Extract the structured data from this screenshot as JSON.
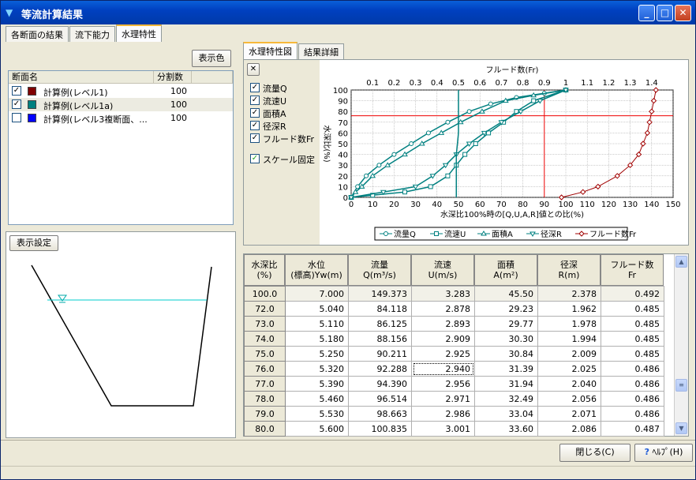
{
  "window": {
    "title": "等流計算結果"
  },
  "main_tabs": [
    "各断面の結果",
    "流下能力",
    "水理特性"
  ],
  "left": {
    "color_button": "表示色",
    "list_headers": [
      "断面名",
      "分割数"
    ],
    "rows": [
      {
        "name": "計算例(レベル1)",
        "div": "100",
        "checked": true,
        "color": "#800000"
      },
      {
        "name": "計算例(レベル1a)",
        "div": "100",
        "checked": true,
        "color": "#008080"
      },
      {
        "name": "計算例(レベル3複断面、...",
        "div": "100",
        "checked": false,
        "color": "#0000ff"
      }
    ],
    "display_settings": "表示設定"
  },
  "right_tabs": [
    "水理特性図",
    "結果詳細"
  ],
  "chart_panel": {
    "close": "✕",
    "checks": [
      "流量Q",
      "流速U",
      "面積A",
      "径深R",
      "フルード数Fr"
    ],
    "scale_fixed": "スケール固定",
    "legend": [
      "流量Q",
      "流速U",
      "面積A",
      "径深R",
      "フルード数Fr"
    ]
  },
  "chart_data": {
    "type": "line",
    "top_axis_title": "フルード数(Fr)",
    "top_ticks": [
      "0.1",
      "0.2",
      "0.3",
      "0.4",
      "0.5",
      "0.6",
      "0.7",
      "0.8",
      "0.9",
      "1",
      "1.1",
      "1.2",
      "1.3",
      "1.4"
    ],
    "ylabel": "水深比(%)",
    "yticks": [
      "0",
      "10",
      "20",
      "30",
      "40",
      "50",
      "60",
      "70",
      "80",
      "90",
      "100"
    ],
    "xlabel": "水深比100%時の[Q,U,A,R]値との比(%)",
    "xticks": [
      "0",
      "10",
      "20",
      "30",
      "40",
      "50",
      "60",
      "70",
      "80",
      "90",
      "100",
      "110",
      "120",
      "130",
      "140",
      "150"
    ],
    "xlim": [
      0,
      150
    ],
    "ylim": [
      0,
      100
    ],
    "crosshair": {
      "x": 90,
      "y": 76
    },
    "series": [
      {
        "name": "流量Q",
        "color": "#008080",
        "marker": "circle",
        "points": [
          [
            0,
            0
          ],
          [
            3,
            10
          ],
          [
            7,
            20
          ],
          [
            13,
            30
          ],
          [
            20,
            40
          ],
          [
            28,
            50
          ],
          [
            36,
            60
          ],
          [
            45,
            70
          ],
          [
            55,
            80
          ],
          [
            65,
            87
          ],
          [
            77,
            93
          ],
          [
            90,
            97
          ],
          [
            100,
            100
          ]
        ]
      },
      {
        "name": "流速U",
        "color": "#008080",
        "marker": "square",
        "points": [
          [
            0,
            0
          ],
          [
            10,
            2
          ],
          [
            25,
            5
          ],
          [
            37,
            10
          ],
          [
            45,
            20
          ],
          [
            49,
            30
          ],
          [
            53,
            40
          ],
          [
            58,
            50
          ],
          [
            64,
            60
          ],
          [
            71,
            70
          ],
          [
            77,
            80
          ],
          [
            85,
            90
          ],
          [
            100,
            100
          ]
        ]
      },
      {
        "name": "面積A",
        "color": "#008080",
        "marker": "triangle",
        "points": [
          [
            0,
            0
          ],
          [
            2,
            5
          ],
          [
            5,
            10
          ],
          [
            10,
            20
          ],
          [
            17,
            30
          ],
          [
            25,
            40
          ],
          [
            33,
            50
          ],
          [
            42,
            60
          ],
          [
            51,
            70
          ],
          [
            61,
            80
          ],
          [
            72,
            90
          ],
          [
            85,
            95
          ],
          [
            100,
            100
          ]
        ]
      },
      {
        "name": "径深R",
        "color": "#008080",
        "marker": "tri-down",
        "points": [
          [
            0,
            0
          ],
          [
            15,
            5
          ],
          [
            30,
            10
          ],
          [
            38,
            20
          ],
          [
            44,
            30
          ],
          [
            49,
            40
          ],
          [
            55,
            50
          ],
          [
            62,
            60
          ],
          [
            70,
            70
          ],
          [
            79,
            80
          ],
          [
            88,
            90
          ],
          [
            100,
            100
          ]
        ]
      },
      {
        "name": "フルード数Fr",
        "color": "#a00000",
        "marker": "diamond",
        "points": [
          [
            98,
            0
          ],
          [
            108,
            5
          ],
          [
            115,
            10
          ],
          [
            124,
            20
          ],
          [
            130,
            30
          ],
          [
            134,
            40
          ],
          [
            136,
            50
          ],
          [
            138,
            60
          ],
          [
            139,
            70
          ],
          [
            140,
            80
          ],
          [
            141,
            90
          ],
          [
            142,
            100
          ]
        ]
      },
      {
        "name": "Fr-base",
        "color": "#008080",
        "marker": "none",
        "points": [
          [
            49,
            0
          ],
          [
            49,
            20
          ],
          [
            49,
            40
          ],
          [
            50,
            60
          ],
          [
            50,
            80
          ],
          [
            50,
            100
          ]
        ]
      }
    ]
  },
  "table": {
    "headers": [
      [
        "水深比",
        "(%)"
      ],
      [
        "水位",
        "(標高)Yw(m)"
      ],
      [
        "流量",
        "Q(m³/s)"
      ],
      [
        "流速",
        "U(m/s)"
      ],
      [
        "面積",
        "A(m²)"
      ],
      [
        "径深",
        "R(m)"
      ],
      [
        "フルード数",
        "Fr"
      ]
    ],
    "fixed": [
      "100.0",
      "7.000",
      "149.373",
      "3.283",
      "45.50",
      "2.378",
      "0.492"
    ],
    "rows": [
      [
        "72.0",
        "5.040",
        "84.118",
        "2.878",
        "29.23",
        "1.962",
        "0.485"
      ],
      [
        "73.0",
        "5.110",
        "86.125",
        "2.893",
        "29.77",
        "1.978",
        "0.485"
      ],
      [
        "74.0",
        "5.180",
        "88.156",
        "2.909",
        "30.30",
        "1.994",
        "0.485"
      ],
      [
        "75.0",
        "5.250",
        "90.211",
        "2.925",
        "30.84",
        "2.009",
        "0.485"
      ],
      [
        "76.0",
        "5.320",
        "92.288",
        "2.940",
        "31.39",
        "2.025",
        "0.486"
      ],
      [
        "77.0",
        "5.390",
        "94.390",
        "2.956",
        "31.94",
        "2.040",
        "0.486"
      ],
      [
        "78.0",
        "5.460",
        "96.514",
        "2.971",
        "32.49",
        "2.056",
        "0.486"
      ],
      [
        "79.0",
        "5.530",
        "98.663",
        "2.986",
        "33.04",
        "2.071",
        "0.486"
      ],
      [
        "80.0",
        "5.600",
        "100.835",
        "3.001",
        "33.60",
        "2.086",
        "0.487"
      ]
    ]
  },
  "footer": {
    "close": "閉じる(C)",
    "help": "ﾍﾙﾌﾟ(H)"
  }
}
